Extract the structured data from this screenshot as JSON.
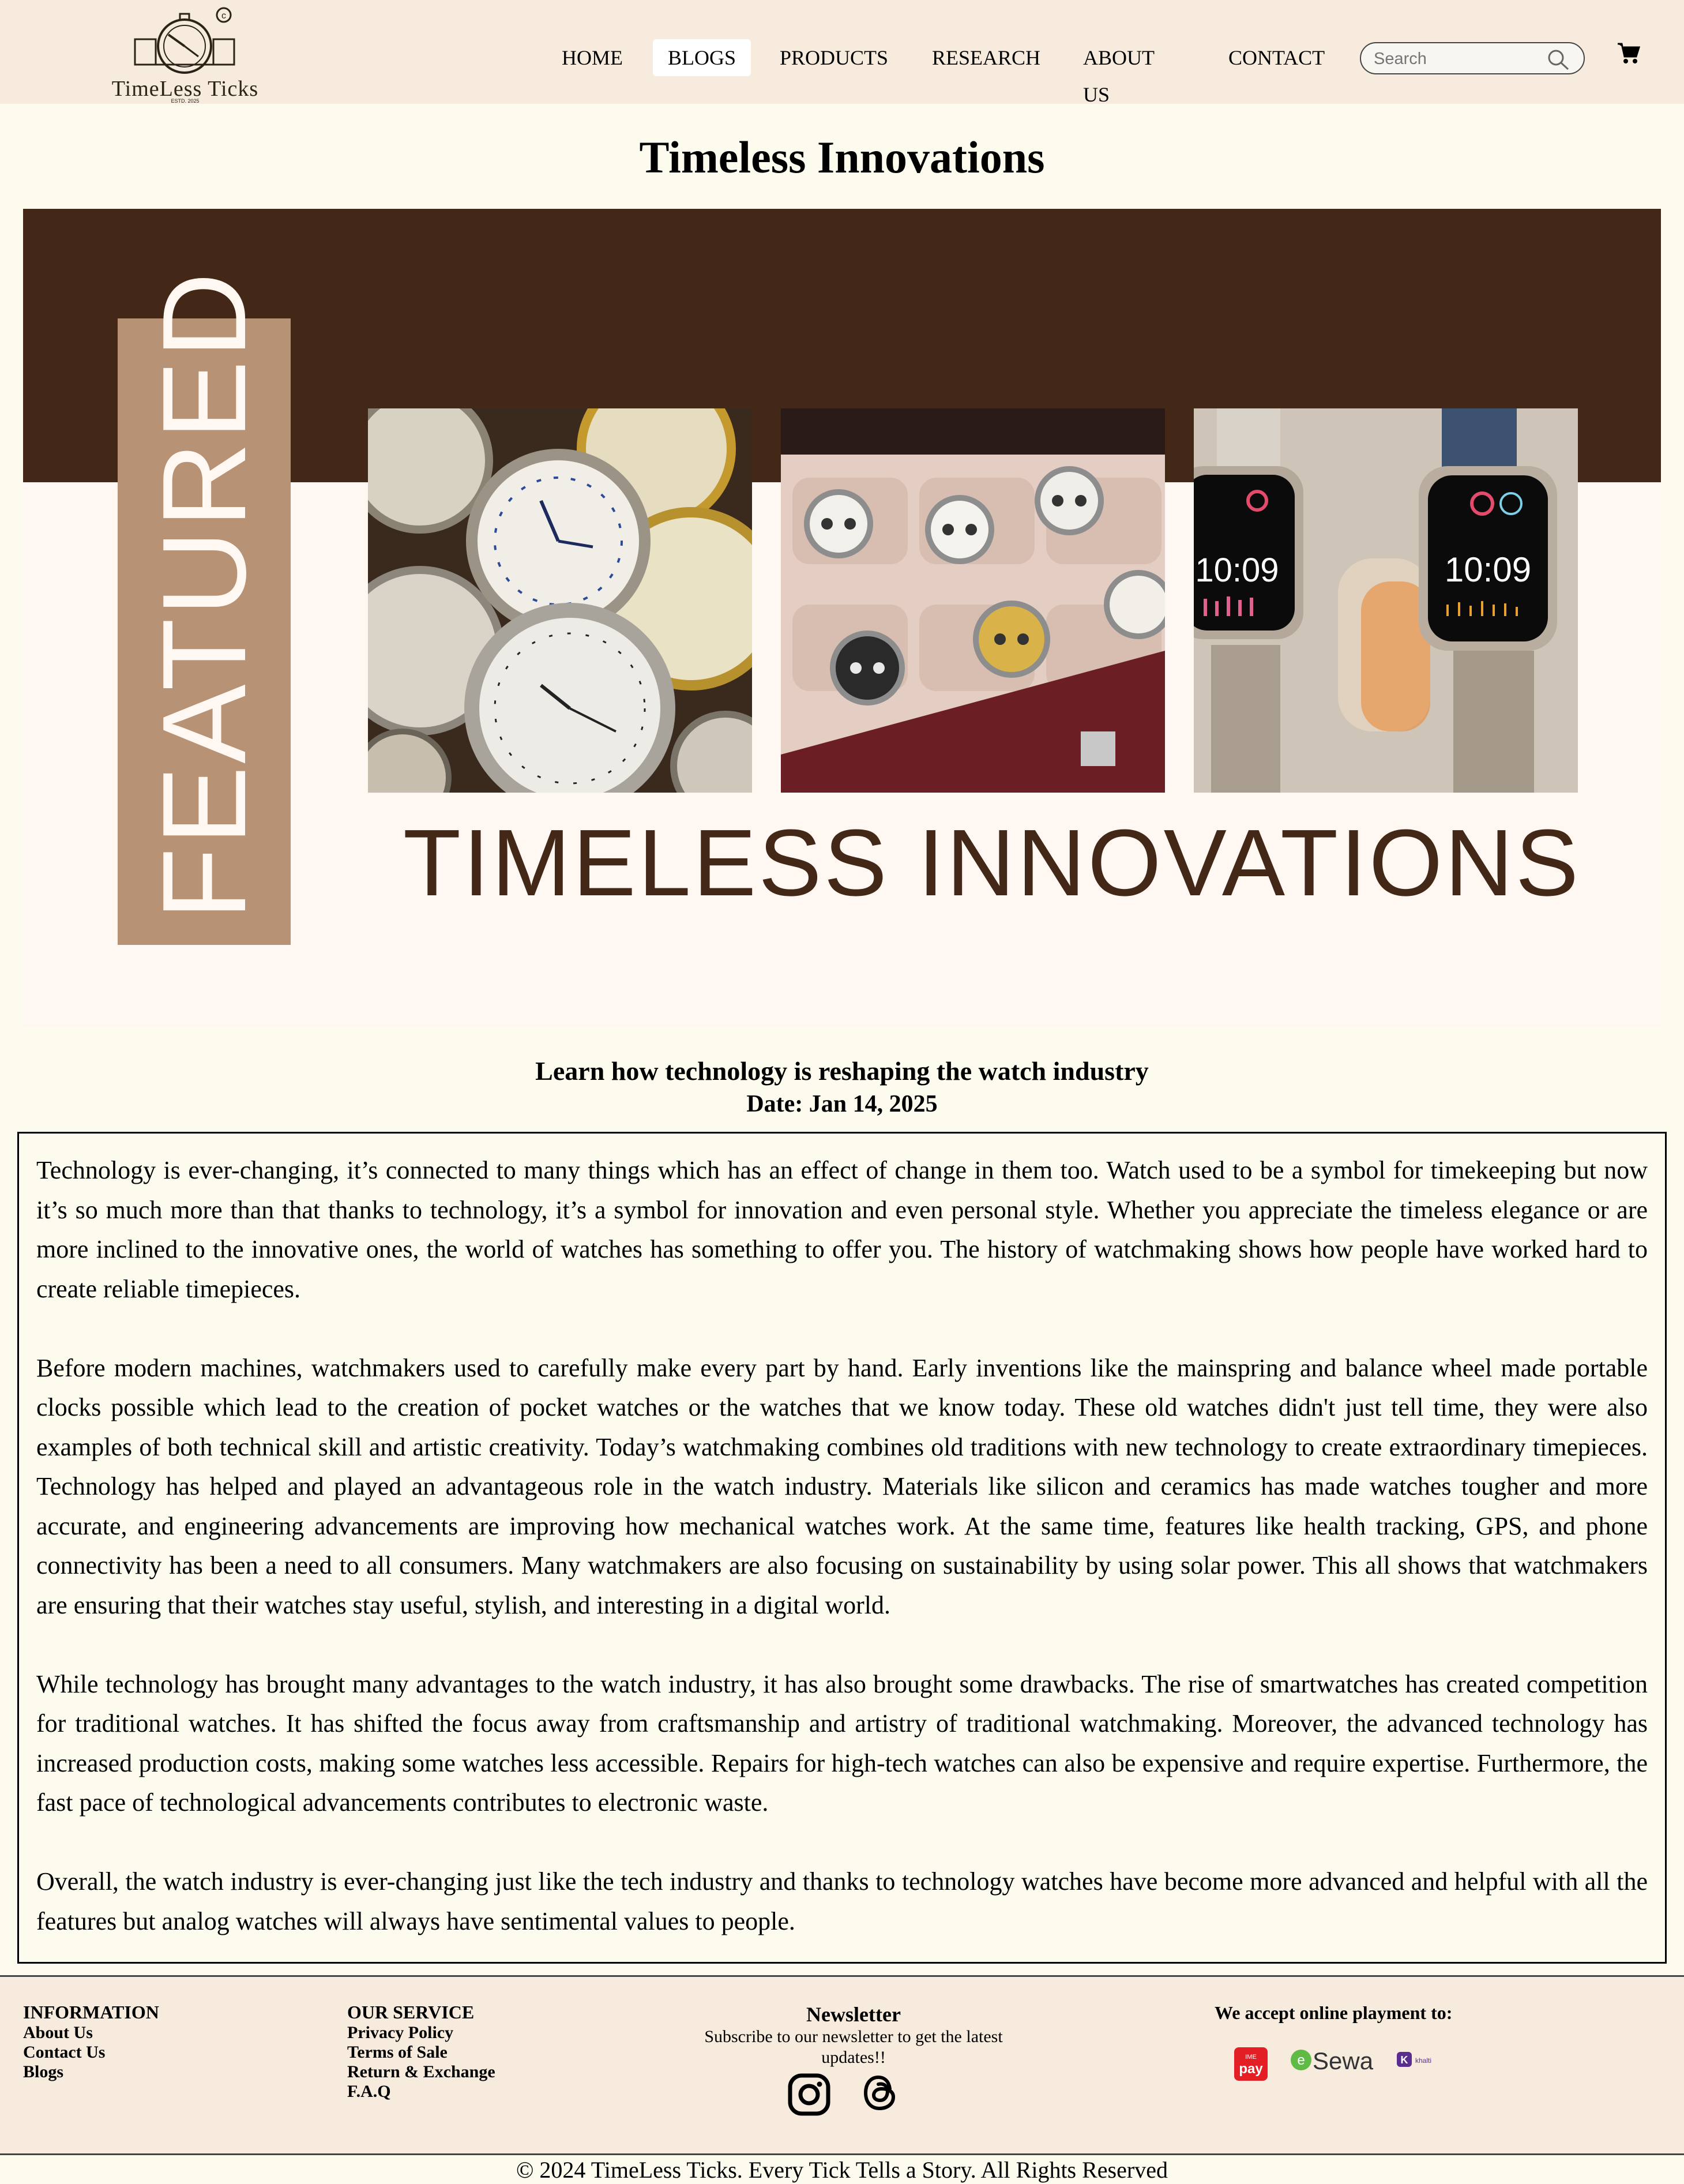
{
  "header": {
    "brand": "TimeLess Ticks",
    "brand_sub": "ESTD. 2025",
    "nav": [
      "HOME",
      "BLOGS",
      "PRODUCTS",
      "RESEARCH",
      "ABOUT US",
      "CONTACT"
    ],
    "active_nav": "BLOGS",
    "search_placeholder": "Search"
  },
  "page_title": "Timeless Innovations",
  "banner": {
    "featured_label": "FEATURED",
    "heading": "TIMELESS INNOVATIONS",
    "colors": {
      "dark": "#432818",
      "tag": "#b79274",
      "light": "#fff7f2"
    },
    "photos": [
      "pocket-watches-photo",
      "watch-case-photo",
      "smartwatches-photo"
    ],
    "smartwatch_time": "10:09"
  },
  "article": {
    "subtitle": "Learn how technology is reshaping the watch industry",
    "date": "Date: Jan 14, 2025",
    "paragraphs": [
      "Technology is ever-changing, it’s connected to many things which has an effect of change in them too. Watch used to be a symbol for timekeeping but now it’s so much more than that thanks to technology, it’s a symbol for innovation and even personal style. Whether you appreciate the timeless elegance or are more inclined to the innovative ones, the world of watches has something to offer you. The history of watchmaking shows how people have worked hard to create reliable timepieces.",
      "Before modern machines, watchmakers used to carefully make every part by hand. Early inventions like the mainspring and balance wheel made portable clocks possible which lead to the creation of pocket watches or the watches that we know today. These old watches didn't just tell time, they were also examples of both technical skill and artistic creativity. Today’s watchmaking combines old traditions with new technology to create extraordinary timepieces. Technology has helped and played an advantageous role in the watch industry. Materials like silicon and ceramics has made watches tougher and more accurate, and engineering advancements are improving how mechanical watches work. At the same time, features like health tracking, GPS, and phone connectivity has been a need to all consumers. Many watchmakers are also focusing on sustainability by using solar power. This all shows that watchmakers are ensuring that their watches stay useful, stylish, and interesting in a digital world.",
      "While technology has brought many advantages to the watch industry, it has also brought some drawbacks. The rise of smartwatches has created competition for traditional watches. It has shifted the focus away from craftsmanship and artistry of traditional watchmaking. Moreover, the advanced technology has increased production costs, making some watches less accessible. Repairs for high-tech watches can also be expensive and require expertise. Furthermore, the fast pace of technological advancements contributes to electronic waste.",
      "Overall, the watch industry is ever-changing just like the tech industry and thanks to technology watches have become more advanced and helpful with all the features but analog watches will always have sentimental values to people."
    ]
  },
  "footer": {
    "information": {
      "title": "INFORMATION",
      "links": [
        "About Us",
        "Contact Us",
        "Blogs"
      ]
    },
    "service": {
      "title": "OUR SERVICE",
      "links": [
        "Privacy Policy",
        "Terms of Sale",
        "Return & Exchange",
        "F.A.Q"
      ]
    },
    "newsletter": {
      "title": "Newsletter",
      "text": "Subscribe to our newsletter to get the latest updates!!"
    },
    "payments": {
      "title": "We accept online playment to:",
      "providers": [
        "IME pay",
        "eSewa",
        "Khalti"
      ],
      "ime_top": "IME",
      "ime_bottom": "pay",
      "esewa": "Sewa",
      "khalti": "khalti"
    },
    "copyright": "© 2024 TimeLess Ticks. Every Tick Tells a Story. All Rights Reserved"
  }
}
